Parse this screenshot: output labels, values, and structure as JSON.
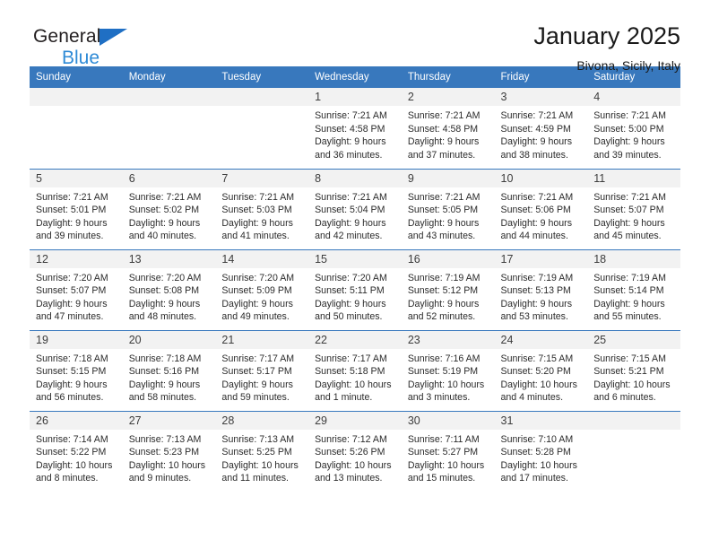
{
  "brand": {
    "line1": "General",
    "line2": "Blue",
    "triangle_color": "#1f6fc4",
    "line2_color": "#2e8ad6"
  },
  "header": {
    "title": "January 2025",
    "location": "Bivona, Sicily, Italy",
    "accent_color": "#3878bd",
    "daynum_band_color": "#f2f2f2"
  },
  "weekday_headers": [
    "Sunday",
    "Monday",
    "Tuesday",
    "Wednesday",
    "Thursday",
    "Friday",
    "Saturday"
  ],
  "labels": {
    "sunrise_prefix": "Sunrise:",
    "sunset_prefix": "Sunset:",
    "daylight_prefix": "Daylight:"
  },
  "weeks": [
    [
      {
        "day": "",
        "sunrise": "",
        "sunset": "",
        "daylight_line1": "",
        "daylight_line2": "",
        "blank": true
      },
      {
        "day": "",
        "sunrise": "",
        "sunset": "",
        "daylight_line1": "",
        "daylight_line2": "",
        "blank": true
      },
      {
        "day": "",
        "sunrise": "",
        "sunset": "",
        "daylight_line1": "",
        "daylight_line2": "",
        "blank": true
      },
      {
        "day": "1",
        "sunrise": "Sunrise: 7:21 AM",
        "sunset": "Sunset: 4:58 PM",
        "daylight_line1": "Daylight: 9 hours",
        "daylight_line2": "and 36 minutes.",
        "blank": false
      },
      {
        "day": "2",
        "sunrise": "Sunrise: 7:21 AM",
        "sunset": "Sunset: 4:58 PM",
        "daylight_line1": "Daylight: 9 hours",
        "daylight_line2": "and 37 minutes.",
        "blank": false
      },
      {
        "day": "3",
        "sunrise": "Sunrise: 7:21 AM",
        "sunset": "Sunset: 4:59 PM",
        "daylight_line1": "Daylight: 9 hours",
        "daylight_line2": "and 38 minutes.",
        "blank": false
      },
      {
        "day": "4",
        "sunrise": "Sunrise: 7:21 AM",
        "sunset": "Sunset: 5:00 PM",
        "daylight_line1": "Daylight: 9 hours",
        "daylight_line2": "and 39 minutes.",
        "blank": false
      }
    ],
    [
      {
        "day": "5",
        "sunrise": "Sunrise: 7:21 AM",
        "sunset": "Sunset: 5:01 PM",
        "daylight_line1": "Daylight: 9 hours",
        "daylight_line2": "and 39 minutes.",
        "blank": false
      },
      {
        "day": "6",
        "sunrise": "Sunrise: 7:21 AM",
        "sunset": "Sunset: 5:02 PM",
        "daylight_line1": "Daylight: 9 hours",
        "daylight_line2": "and 40 minutes.",
        "blank": false
      },
      {
        "day": "7",
        "sunrise": "Sunrise: 7:21 AM",
        "sunset": "Sunset: 5:03 PM",
        "daylight_line1": "Daylight: 9 hours",
        "daylight_line2": "and 41 minutes.",
        "blank": false
      },
      {
        "day": "8",
        "sunrise": "Sunrise: 7:21 AM",
        "sunset": "Sunset: 5:04 PM",
        "daylight_line1": "Daylight: 9 hours",
        "daylight_line2": "and 42 minutes.",
        "blank": false
      },
      {
        "day": "9",
        "sunrise": "Sunrise: 7:21 AM",
        "sunset": "Sunset: 5:05 PM",
        "daylight_line1": "Daylight: 9 hours",
        "daylight_line2": "and 43 minutes.",
        "blank": false
      },
      {
        "day": "10",
        "sunrise": "Sunrise: 7:21 AM",
        "sunset": "Sunset: 5:06 PM",
        "daylight_line1": "Daylight: 9 hours",
        "daylight_line2": "and 44 minutes.",
        "blank": false
      },
      {
        "day": "11",
        "sunrise": "Sunrise: 7:21 AM",
        "sunset": "Sunset: 5:07 PM",
        "daylight_line1": "Daylight: 9 hours",
        "daylight_line2": "and 45 minutes.",
        "blank": false
      }
    ],
    [
      {
        "day": "12",
        "sunrise": "Sunrise: 7:20 AM",
        "sunset": "Sunset: 5:07 PM",
        "daylight_line1": "Daylight: 9 hours",
        "daylight_line2": "and 47 minutes.",
        "blank": false
      },
      {
        "day": "13",
        "sunrise": "Sunrise: 7:20 AM",
        "sunset": "Sunset: 5:08 PM",
        "daylight_line1": "Daylight: 9 hours",
        "daylight_line2": "and 48 minutes.",
        "blank": false
      },
      {
        "day": "14",
        "sunrise": "Sunrise: 7:20 AM",
        "sunset": "Sunset: 5:09 PM",
        "daylight_line1": "Daylight: 9 hours",
        "daylight_line2": "and 49 minutes.",
        "blank": false
      },
      {
        "day": "15",
        "sunrise": "Sunrise: 7:20 AM",
        "sunset": "Sunset: 5:11 PM",
        "daylight_line1": "Daylight: 9 hours",
        "daylight_line2": "and 50 minutes.",
        "blank": false
      },
      {
        "day": "16",
        "sunrise": "Sunrise: 7:19 AM",
        "sunset": "Sunset: 5:12 PM",
        "daylight_line1": "Daylight: 9 hours",
        "daylight_line2": "and 52 minutes.",
        "blank": false
      },
      {
        "day": "17",
        "sunrise": "Sunrise: 7:19 AM",
        "sunset": "Sunset: 5:13 PM",
        "daylight_line1": "Daylight: 9 hours",
        "daylight_line2": "and 53 minutes.",
        "blank": false
      },
      {
        "day": "18",
        "sunrise": "Sunrise: 7:19 AM",
        "sunset": "Sunset: 5:14 PM",
        "daylight_line1": "Daylight: 9 hours",
        "daylight_line2": "and 55 minutes.",
        "blank": false
      }
    ],
    [
      {
        "day": "19",
        "sunrise": "Sunrise: 7:18 AM",
        "sunset": "Sunset: 5:15 PM",
        "daylight_line1": "Daylight: 9 hours",
        "daylight_line2": "and 56 minutes.",
        "blank": false
      },
      {
        "day": "20",
        "sunrise": "Sunrise: 7:18 AM",
        "sunset": "Sunset: 5:16 PM",
        "daylight_line1": "Daylight: 9 hours",
        "daylight_line2": "and 58 minutes.",
        "blank": false
      },
      {
        "day": "21",
        "sunrise": "Sunrise: 7:17 AM",
        "sunset": "Sunset: 5:17 PM",
        "daylight_line1": "Daylight: 9 hours",
        "daylight_line2": "and 59 minutes.",
        "blank": false
      },
      {
        "day": "22",
        "sunrise": "Sunrise: 7:17 AM",
        "sunset": "Sunset: 5:18 PM",
        "daylight_line1": "Daylight: 10 hours",
        "daylight_line2": "and 1 minute.",
        "blank": false
      },
      {
        "day": "23",
        "sunrise": "Sunrise: 7:16 AM",
        "sunset": "Sunset: 5:19 PM",
        "daylight_line1": "Daylight: 10 hours",
        "daylight_line2": "and 3 minutes.",
        "blank": false
      },
      {
        "day": "24",
        "sunrise": "Sunrise: 7:15 AM",
        "sunset": "Sunset: 5:20 PM",
        "daylight_line1": "Daylight: 10 hours",
        "daylight_line2": "and 4 minutes.",
        "blank": false
      },
      {
        "day": "25",
        "sunrise": "Sunrise: 7:15 AM",
        "sunset": "Sunset: 5:21 PM",
        "daylight_line1": "Daylight: 10 hours",
        "daylight_line2": "and 6 minutes.",
        "blank": false
      }
    ],
    [
      {
        "day": "26",
        "sunrise": "Sunrise: 7:14 AM",
        "sunset": "Sunset: 5:22 PM",
        "daylight_line1": "Daylight: 10 hours",
        "daylight_line2": "and 8 minutes.",
        "blank": false
      },
      {
        "day": "27",
        "sunrise": "Sunrise: 7:13 AM",
        "sunset": "Sunset: 5:23 PM",
        "daylight_line1": "Daylight: 10 hours",
        "daylight_line2": "and 9 minutes.",
        "blank": false
      },
      {
        "day": "28",
        "sunrise": "Sunrise: 7:13 AM",
        "sunset": "Sunset: 5:25 PM",
        "daylight_line1": "Daylight: 10 hours",
        "daylight_line2": "and 11 minutes.",
        "blank": false
      },
      {
        "day": "29",
        "sunrise": "Sunrise: 7:12 AM",
        "sunset": "Sunset: 5:26 PM",
        "daylight_line1": "Daylight: 10 hours",
        "daylight_line2": "and 13 minutes.",
        "blank": false
      },
      {
        "day": "30",
        "sunrise": "Sunrise: 7:11 AM",
        "sunset": "Sunset: 5:27 PM",
        "daylight_line1": "Daylight: 10 hours",
        "daylight_line2": "and 15 minutes.",
        "blank": false
      },
      {
        "day": "31",
        "sunrise": "Sunrise: 7:10 AM",
        "sunset": "Sunset: 5:28 PM",
        "daylight_line1": "Daylight: 10 hours",
        "daylight_line2": "and 17 minutes.",
        "blank": false
      },
      {
        "day": "",
        "sunrise": "",
        "sunset": "",
        "daylight_line1": "",
        "daylight_line2": "",
        "blank": true
      }
    ]
  ]
}
